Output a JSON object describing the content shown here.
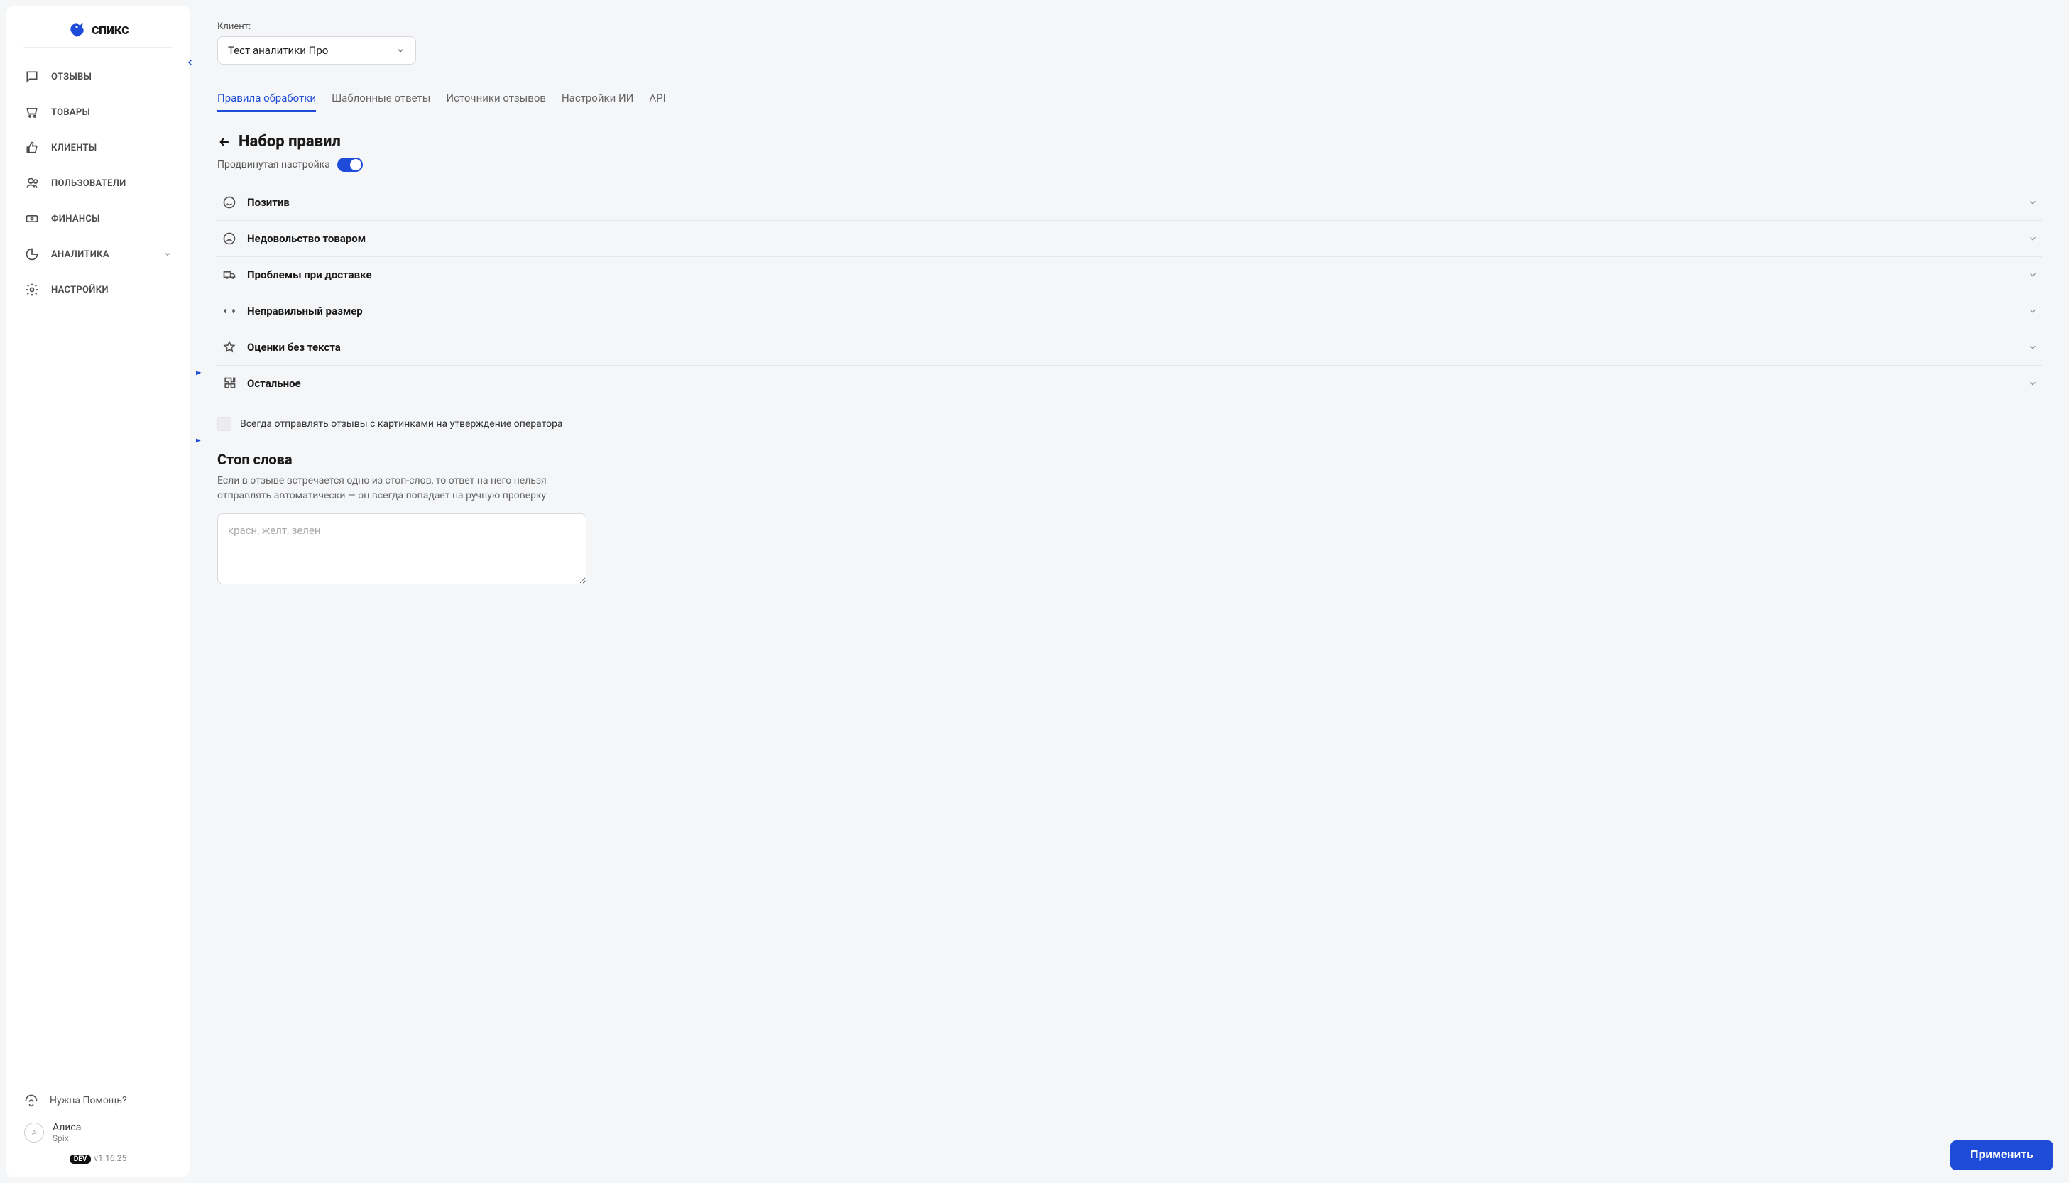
{
  "sidebar": {
    "brand": "спикс",
    "items": [
      {
        "label": "ОТЗЫВЫ",
        "icon": "chat"
      },
      {
        "label": "ТОВАРЫ",
        "icon": "cart"
      },
      {
        "label": "КЛИЕНТЫ",
        "icon": "thumbs-up"
      },
      {
        "label": "ПОЛЬЗОВАТЕЛИ",
        "icon": "users"
      },
      {
        "label": "ФИНАНСЫ",
        "icon": "money"
      },
      {
        "label": "АНАЛИТИКА",
        "icon": "pie",
        "has_children": true
      },
      {
        "label": "НАСТРОЙКИ",
        "icon": "gear"
      }
    ],
    "help": "Нужна Помощь?",
    "user": {
      "name": "Алиса",
      "org": "Spix",
      "initial": "A"
    },
    "env_badge": "DEV",
    "version": "v1.16.25"
  },
  "client": {
    "label": "Клиент:",
    "selected": "Тест аналитики Про"
  },
  "tabs": [
    {
      "label": "Правила обработки",
      "active": true
    },
    {
      "label": "Шаблонные ответы"
    },
    {
      "label": "Источники отзывов"
    },
    {
      "label": "Настройки ИИ"
    },
    {
      "label": "API"
    }
  ],
  "ruleset": {
    "title": "Набор правил",
    "advanced_label": "Продвинутая настройка",
    "advanced_on": true,
    "groups": [
      {
        "label": "Позитив",
        "icon": "smile"
      },
      {
        "label": "Недовольство товаром",
        "icon": "sad"
      },
      {
        "label": "Проблемы при доставке",
        "icon": "delivery"
      },
      {
        "label": "Неправильный размер",
        "icon": "resize"
      },
      {
        "label": "Оценки без текста",
        "icon": "star"
      },
      {
        "label": "Остальное",
        "icon": "puzzle"
      }
    ]
  },
  "always_images_checkbox": {
    "label": "Всегда отправлять отзывы с картинками на утверждение оператора",
    "checked": false
  },
  "stopwords": {
    "title": "Стоп слова",
    "description": "Если в отзыве встречается одно из стоп-слов, то ответ на него нельзя отправлять автоматически — он всегда попадает на ручную проверку",
    "placeholder": "красн, желт, зелен",
    "value": ""
  },
  "apply_button": "Применить",
  "annotations": {
    "a1": "1",
    "a2": "2"
  },
  "colors": {
    "accent": "#1e4cd8"
  }
}
